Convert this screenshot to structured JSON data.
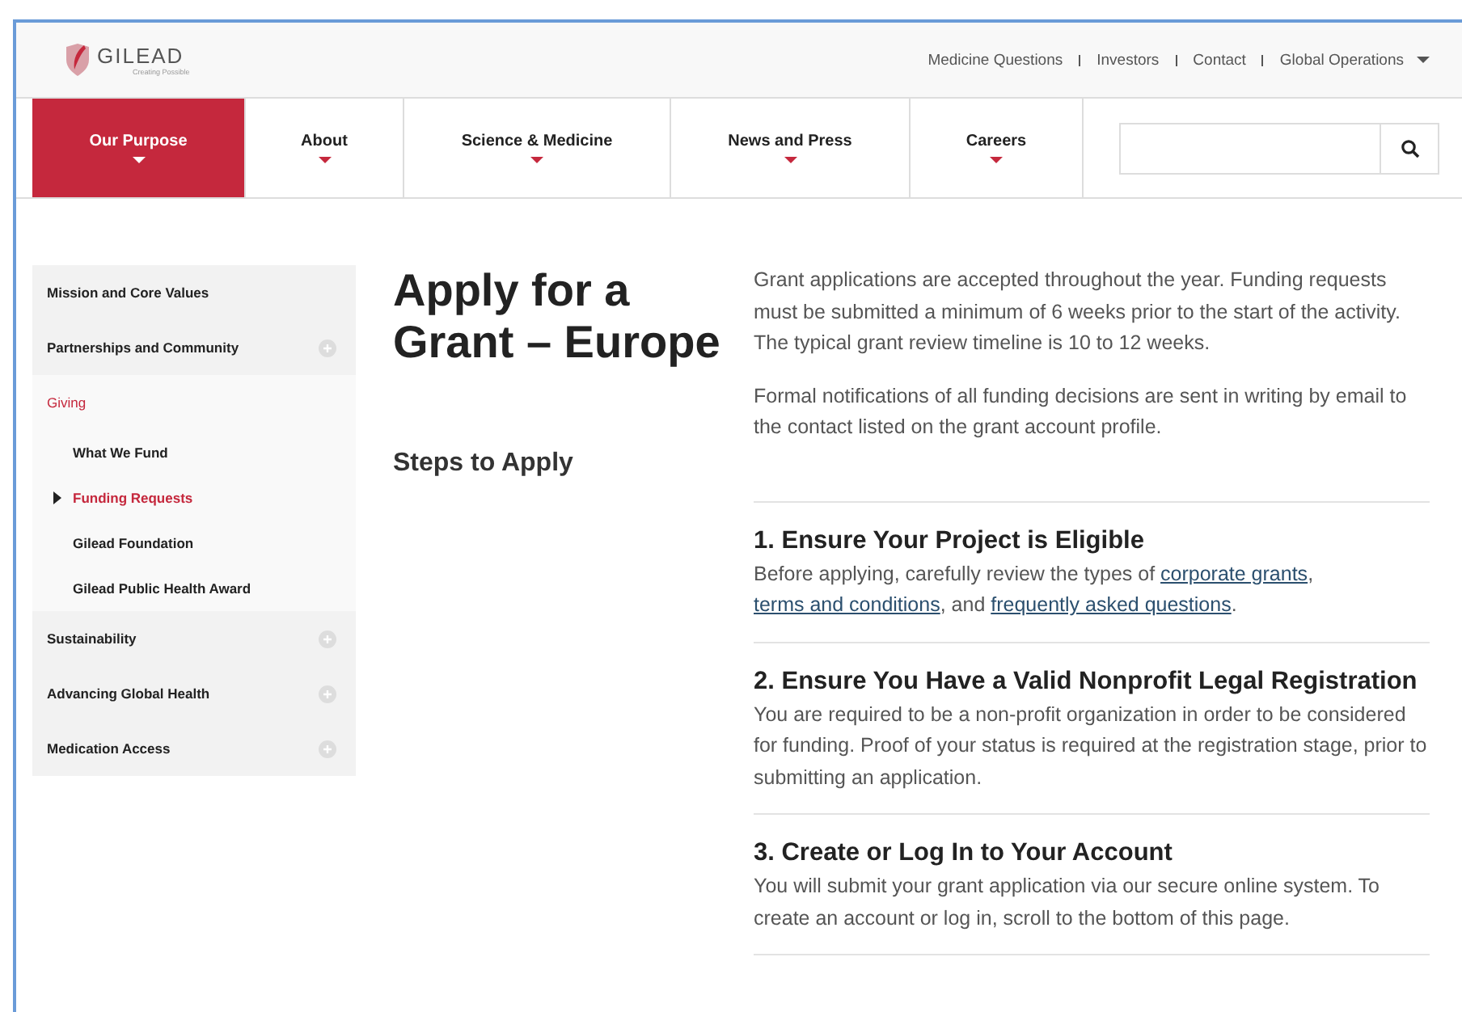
{
  "logo": {
    "name": "GILEAD",
    "tagline": "Creating Possible"
  },
  "utility_links": [
    {
      "label": "Medicine Questions",
      "dropdown": false
    },
    {
      "label": "Investors",
      "dropdown": false
    },
    {
      "label": "Contact",
      "dropdown": false
    },
    {
      "label": "Global Operations",
      "dropdown": true
    }
  ],
  "nav": [
    {
      "label": "Our Purpose",
      "selected": true
    },
    {
      "label": "About",
      "selected": false
    },
    {
      "label": "Science & Medicine",
      "selected": false
    },
    {
      "label": "News and Press",
      "selected": false
    },
    {
      "label": "Careers",
      "selected": false
    }
  ],
  "sidebar": {
    "items": [
      {
        "label": "Mission and Core Values",
        "expandable": false,
        "selected": false
      },
      {
        "label": "Partnerships and Community",
        "expandable": true,
        "selected": false
      },
      {
        "label": "Giving",
        "expandable": false,
        "selected": true,
        "children": [
          {
            "label": "What We Fund",
            "selected": false
          },
          {
            "label": "Funding Requests",
            "selected": true
          },
          {
            "label": "Gilead Foundation",
            "selected": false
          },
          {
            "label": "Gilead Public Health Award",
            "selected": false
          }
        ]
      },
      {
        "label": "Sustainability",
        "expandable": true,
        "selected": false
      },
      {
        "label": "Advancing Global Health",
        "expandable": true,
        "selected": false
      },
      {
        "label": "Medication Access",
        "expandable": true,
        "selected": false
      }
    ]
  },
  "page_title": "Apply for a Grant – Europe",
  "section_title": "Steps to Apply",
  "intro": [
    "Grant applications are accepted throughout the year. Funding requests must be submitted a minimum of 6 weeks prior to the start of the activity. The typical grant review timeline is 10 to 12 weeks.",
    "Formal notifications of all funding decisions are sent in writing by email to the contact listed on the grant account profile."
  ],
  "steps": [
    {
      "title": "1. Ensure Your Project is Eligible",
      "body": [
        {
          "kind": "text",
          "text": "Before applying, carefully review the types of "
        },
        {
          "kind": "link",
          "text": "corporate grants"
        },
        {
          "kind": "text",
          "text": ", "
        },
        {
          "kind": "link",
          "text": "terms and conditions"
        },
        {
          "kind": "text",
          "text": ", and "
        },
        {
          "kind": "link",
          "text": "frequently asked questions"
        },
        {
          "kind": "text",
          "text": "."
        }
      ]
    },
    {
      "title": "2. Ensure You Have a Valid Nonprofit Legal Registration",
      "body": [
        {
          "kind": "text",
          "text": "You are required to be a non-profit organization in order to be considered for funding. Proof of your status is required at the registration stage, prior to submitting an application."
        }
      ]
    },
    {
      "title": "3. Create or Log In to Your Account",
      "body": [
        {
          "kind": "text",
          "text": "You will submit your grant application via our secure online system. To create an account or log in, scroll to the bottom of this page."
        }
      ]
    }
  ]
}
